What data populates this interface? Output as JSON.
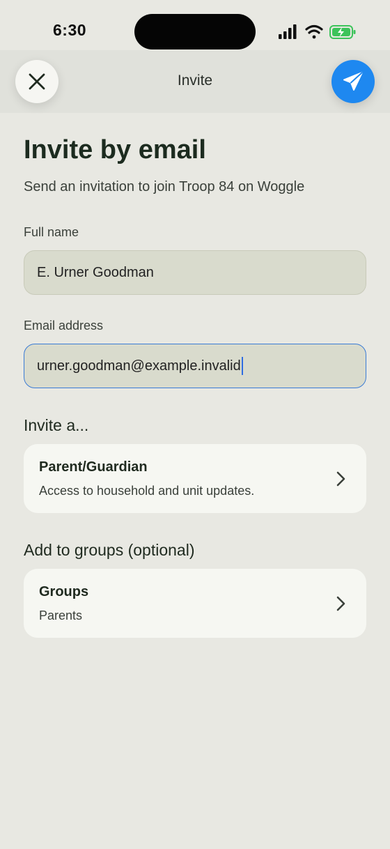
{
  "status": {
    "time": "6:30"
  },
  "nav": {
    "title": "Invite",
    "close_icon": "close-x-icon",
    "send_icon": "paper-plane-icon",
    "send_color": "#1e88f0"
  },
  "page": {
    "title": "Invite by email",
    "subtitle": "Send an invitation to join Troop 84 on Woggle"
  },
  "form": {
    "full_name": {
      "label": "Full name",
      "value": "E. Urner Goodman"
    },
    "email": {
      "label": "Email address",
      "value": "urner.goodman@example.invalid"
    }
  },
  "invite_role": {
    "heading": "Invite a...",
    "title": "Parent/Guardian",
    "description": "Access to household and unit updates."
  },
  "groups": {
    "heading": "Add to groups (optional)",
    "title": "Groups",
    "value": "Parents"
  }
}
